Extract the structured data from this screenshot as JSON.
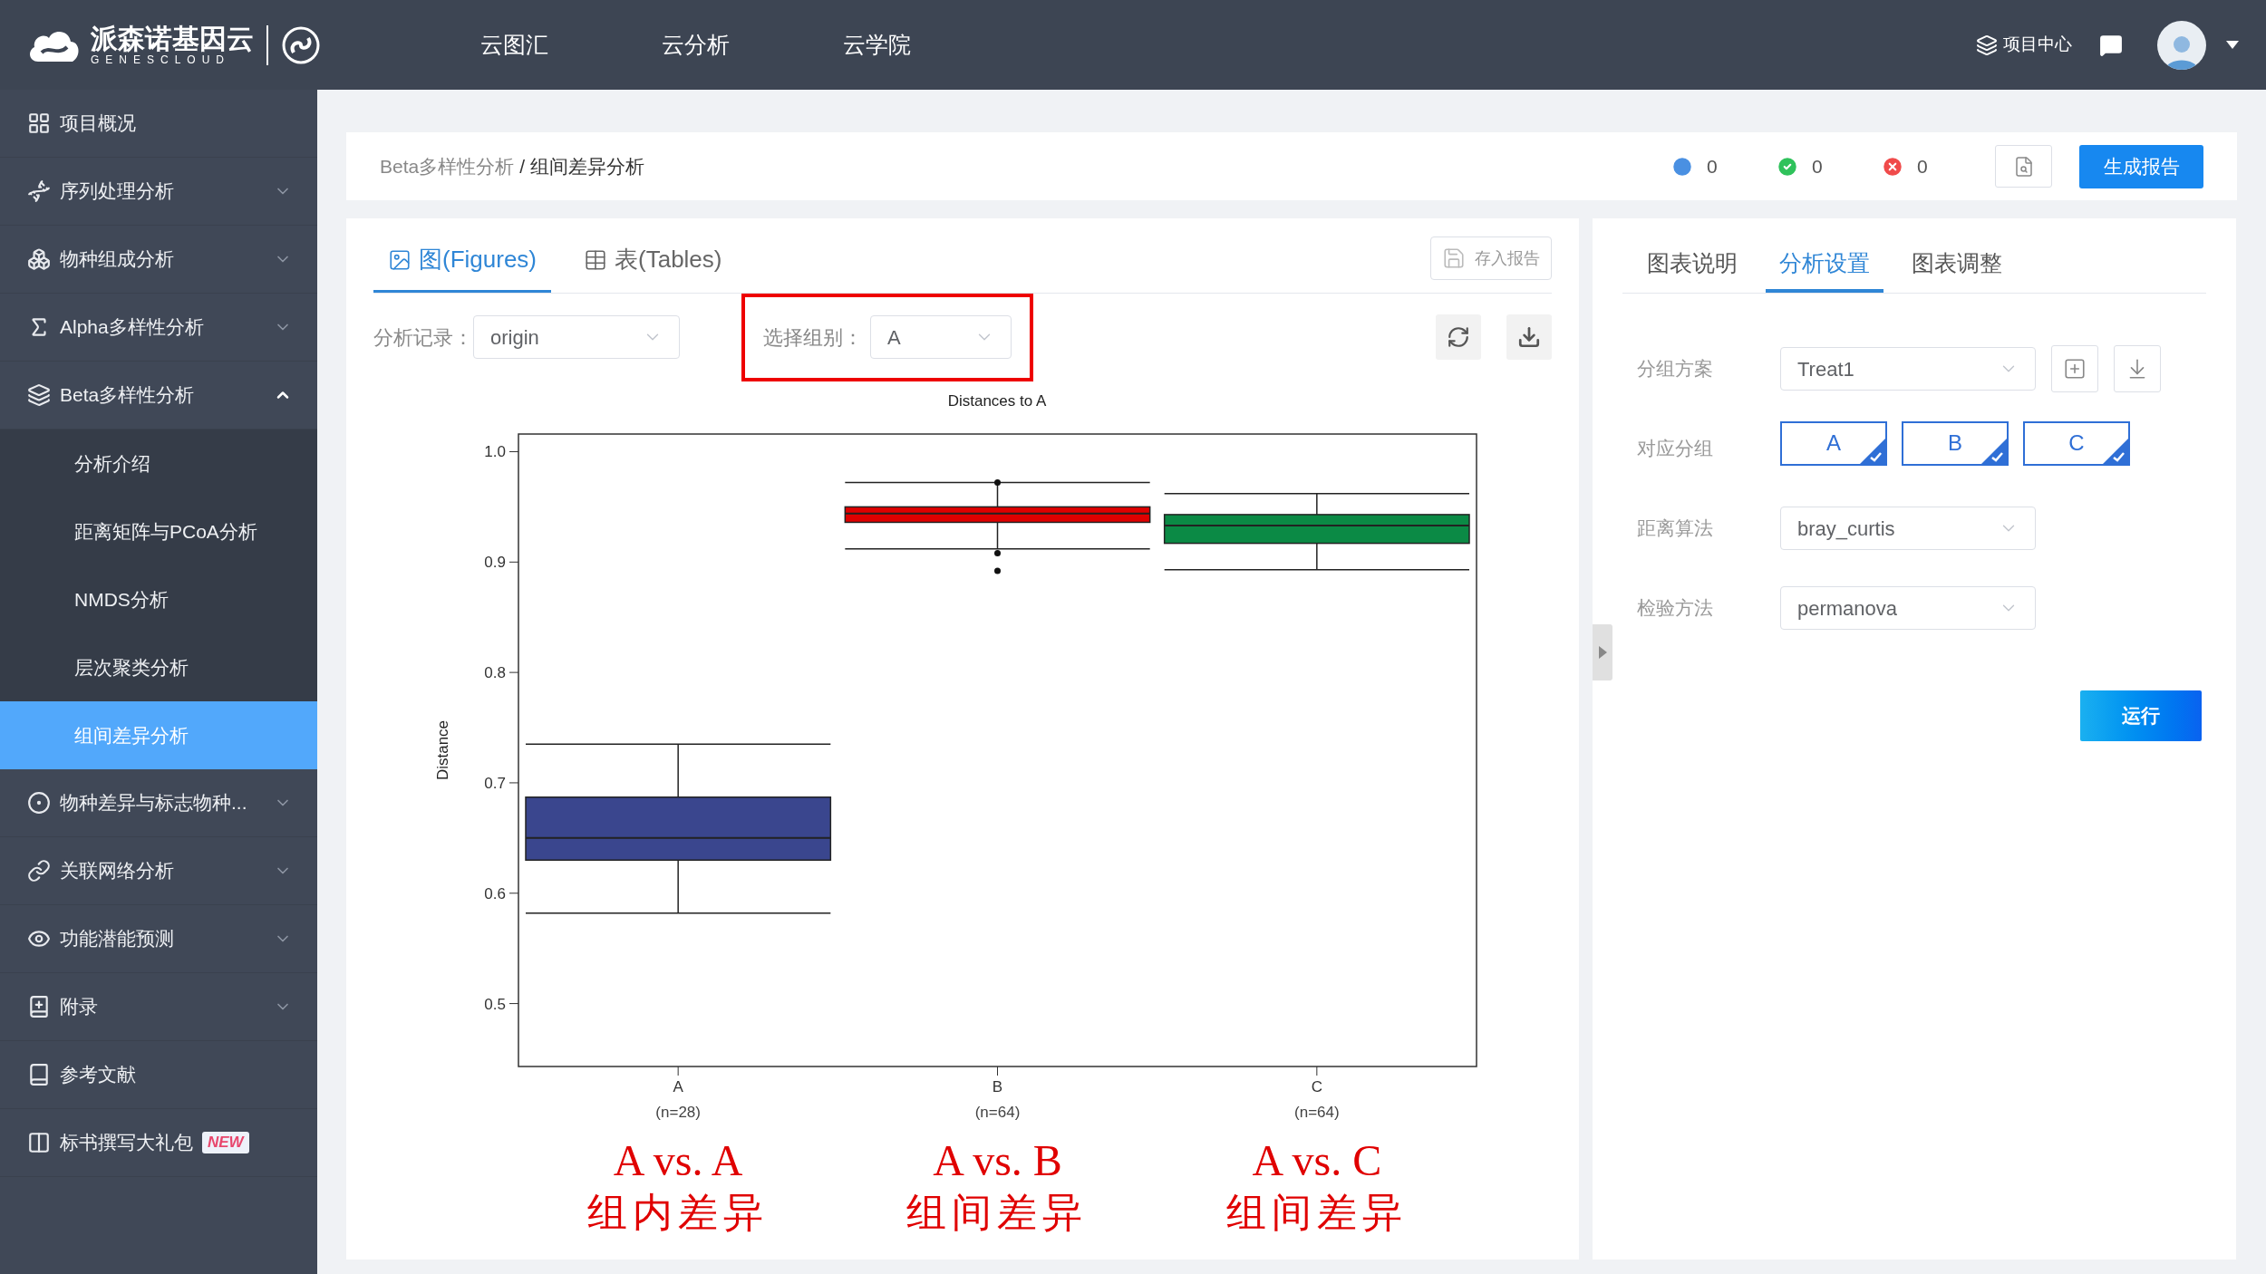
{
  "brand": {
    "name": "派森诺基因云",
    "subtitle": "GENESCLOUD"
  },
  "top_nav": [
    {
      "label": "云图汇"
    },
    {
      "label": "云分析"
    },
    {
      "label": "云学院"
    }
  ],
  "user_bar": {
    "project_center": "项目中心"
  },
  "sidebar": {
    "items": [
      {
        "kind": "link",
        "label": "项目概况"
      },
      {
        "kind": "group",
        "label": "序列处理分析",
        "expanded": false
      },
      {
        "kind": "group",
        "label": "物种组成分析",
        "expanded": false
      },
      {
        "kind": "group",
        "label": "Alpha多样性分析",
        "expanded": false
      },
      {
        "kind": "group",
        "label": "Beta多样性分析",
        "expanded": true,
        "children": [
          {
            "label": "分析介绍",
            "selected": false
          },
          {
            "label": "距离矩阵与PCoA分析",
            "selected": false
          },
          {
            "label": "NMDS分析",
            "selected": false
          },
          {
            "label": "层次聚类分析",
            "selected": false
          },
          {
            "label": "组间差异分析",
            "selected": true
          }
        ]
      },
      {
        "kind": "group",
        "label": "物种差异与标志物种...",
        "expanded": false
      },
      {
        "kind": "group",
        "label": "关联网络分析",
        "expanded": false
      },
      {
        "kind": "group",
        "label": "功能潜能预测",
        "expanded": false
      },
      {
        "kind": "group",
        "label": "附录",
        "expanded": false
      },
      {
        "kind": "link",
        "label": "参考文献"
      },
      {
        "kind": "link",
        "label": "标书撰写大礼包",
        "badge": "NEW"
      }
    ]
  },
  "breadcrumb": {
    "parent": "Beta多样性分析",
    "separator": "/",
    "current": "组间差异分析"
  },
  "status_counts": [
    {
      "kind": "pending",
      "count": "0"
    },
    {
      "kind": "success",
      "count": "0"
    },
    {
      "kind": "error",
      "count": "0"
    }
  ],
  "generate_button": "生成报告",
  "figure_panel": {
    "tabs": [
      {
        "label": "图(Figures)",
        "selected": true
      },
      {
        "label": "表(Tables)",
        "selected": false
      }
    ],
    "save_button": "存入报告",
    "record": {
      "label": "分析记录：",
      "value": "origin"
    },
    "group_select": {
      "label": "选择组别：",
      "value": "A",
      "highlighted": true
    },
    "boxplot": {
      "title": "Distances to A",
      "ylabel": "Distance",
      "yticks": [
        "1.0",
        "0.9",
        "0.8",
        "0.7",
        "0.6",
        "0.5"
      ],
      "groups": [
        {
          "label": "A",
          "note": "(n=28)",
          "color": "#3a468e"
        },
        {
          "label": "B",
          "note": "(n=64)",
          "color": "#e00000"
        },
        {
          "label": "C",
          "note": "(n=64)",
          "color": "#0b8a45"
        }
      ]
    },
    "annotations": [
      {
        "text": "A vs. A",
        "note": "组内差异"
      },
      {
        "text": "A vs. B",
        "note": "组间差异"
      },
      {
        "text": "A vs. C",
        "note": "组间差异"
      }
    ]
  },
  "settings_panel": {
    "tabs": [
      {
        "label": "图表说明",
        "selected": false
      },
      {
        "label": "分析设置",
        "selected": true
      },
      {
        "label": "图表调整",
        "selected": false
      }
    ],
    "fields": [
      {
        "kind": "select-with-actions",
        "label": "分组方案",
        "value": "Treat1"
      },
      {
        "kind": "groups",
        "label": "对应分组",
        "options": [
          {
            "label": "A",
            "checked": true
          },
          {
            "label": "B",
            "checked": true
          },
          {
            "label": "C",
            "checked": true
          }
        ]
      },
      {
        "kind": "select",
        "label": "距离算法",
        "value": "bray_curtis"
      },
      {
        "kind": "select",
        "label": "检验方法",
        "value": "permanova"
      }
    ],
    "run_button": "运行"
  }
}
